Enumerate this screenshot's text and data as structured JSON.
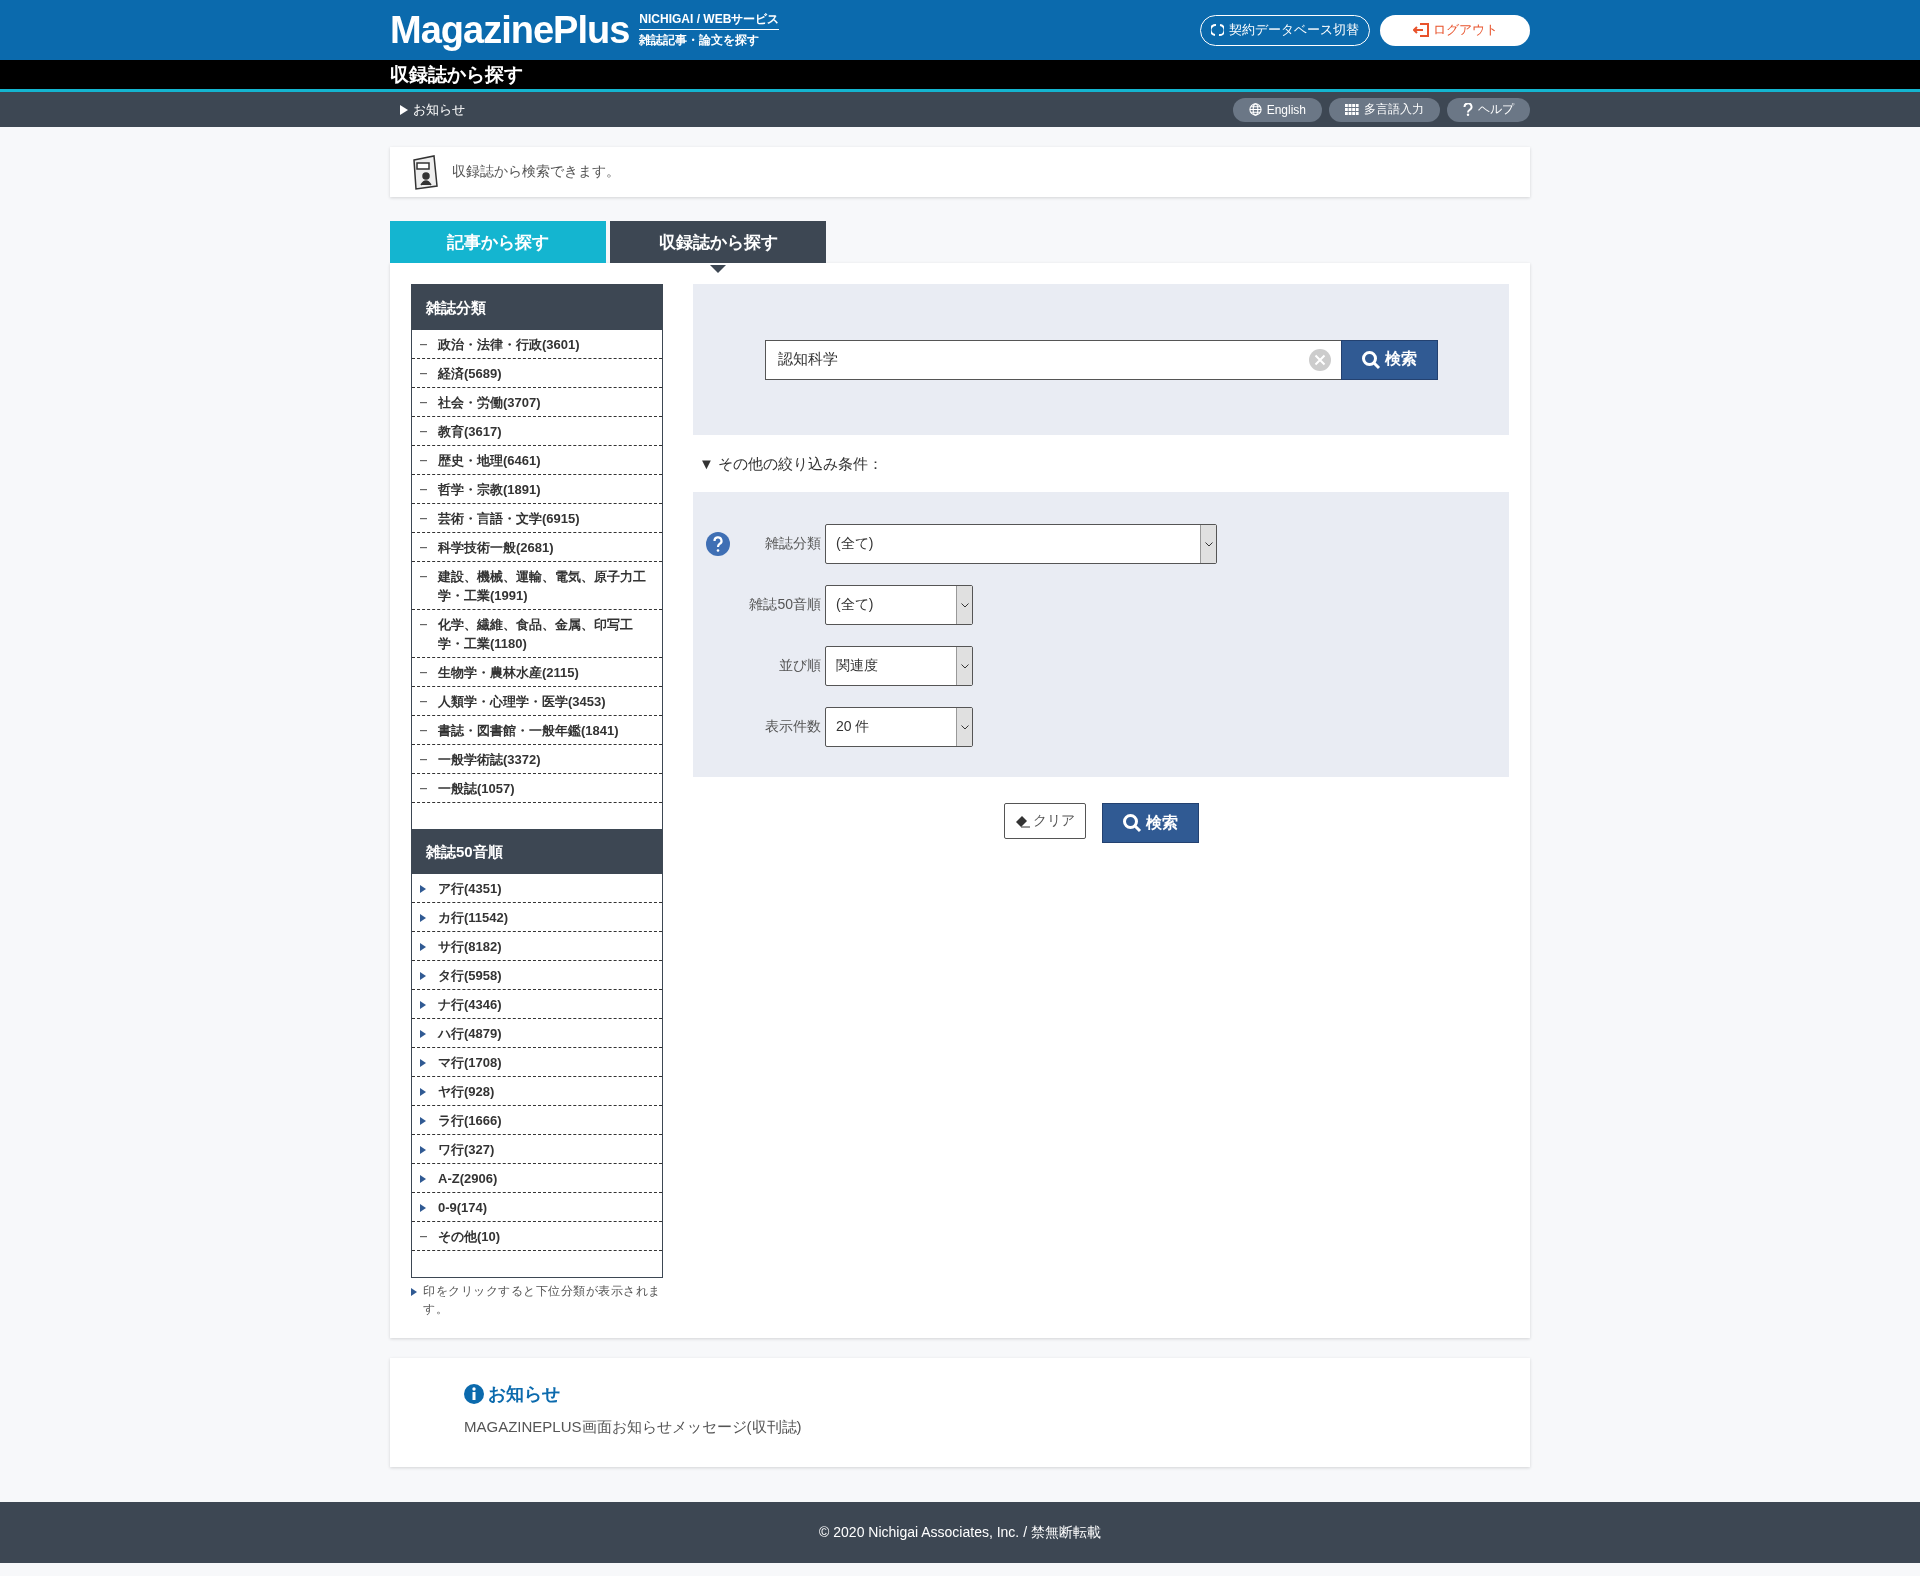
{
  "header": {
    "logo": "MagazinePlus",
    "service": "NICHIGAI / WEBサービス",
    "tagline": "雑誌記事・論文を探す",
    "switch_button": "契約データベース切替",
    "logout_button": "ログアウト"
  },
  "title_bar": {
    "title": "収録誌から探す"
  },
  "sub_bar": {
    "notice_link": "お知らせ",
    "buttons": [
      {
        "label": "English",
        "kind": "globe"
      },
      {
        "label": "多言語入力",
        "kind": "grid"
      },
      {
        "label": "ヘルプ",
        "kind": "help"
      }
    ]
  },
  "info": {
    "text": "収録誌から検索できます。"
  },
  "tabs": [
    {
      "label": "記事から探す",
      "selected": false
    },
    {
      "label": "収録誌から探す",
      "selected": true
    }
  ],
  "sidebar": {
    "sections": [
      {
        "title": "雑誌分類",
        "items": [
          {
            "label": "政治・法律・行政(3601)",
            "kind": "leaf"
          },
          {
            "label": "経済(5689)",
            "kind": "leaf"
          },
          {
            "label": "社会・労働(3707)",
            "kind": "leaf"
          },
          {
            "label": "教育(3617)",
            "kind": "leaf"
          },
          {
            "label": "歴史・地理(6461)",
            "kind": "leaf"
          },
          {
            "label": "哲学・宗教(1891)",
            "kind": "leaf"
          },
          {
            "label": "芸術・言語・文学(6915)",
            "kind": "leaf"
          },
          {
            "label": "科学技術一般(2681)",
            "kind": "leaf"
          },
          {
            "label": "建設、機械、運輸、電気、原子力工学・工業(1991)",
            "kind": "leaf"
          },
          {
            "label": "化学、繊維、食品、金属、印写工学・工業(1180)",
            "kind": "leaf"
          },
          {
            "label": "生物学・農林水産(2115)",
            "kind": "leaf"
          },
          {
            "label": "人類学・心理学・医学(3453)",
            "kind": "leaf"
          },
          {
            "label": "書誌・図書館・一般年鑑(1841)",
            "kind": "leaf"
          },
          {
            "label": "一般学術誌(3372)",
            "kind": "leaf"
          },
          {
            "label": "一般誌(1057)",
            "kind": "leaf"
          }
        ]
      },
      {
        "title": "雑誌50音順",
        "items": [
          {
            "label": "ア行(4351)",
            "kind": "branch"
          },
          {
            "label": "カ行(11542)",
            "kind": "branch"
          },
          {
            "label": "サ行(8182)",
            "kind": "branch"
          },
          {
            "label": "タ行(5958)",
            "kind": "branch"
          },
          {
            "label": "ナ行(4346)",
            "kind": "branch"
          },
          {
            "label": "ハ行(4879)",
            "kind": "branch"
          },
          {
            "label": "マ行(1708)",
            "kind": "branch"
          },
          {
            "label": "ヤ行(928)",
            "kind": "branch"
          },
          {
            "label": "ラ行(1666)",
            "kind": "branch"
          },
          {
            "label": "ワ行(327)",
            "kind": "branch"
          },
          {
            "label": "A-Z(2906)",
            "kind": "branch"
          },
          {
            "label": "0-9(174)",
            "kind": "branch"
          },
          {
            "label": "その他(10)",
            "kind": "leaf"
          }
        ]
      }
    ],
    "note": "印をクリックすると下位分類が表示されます。"
  },
  "search": {
    "value": "認知科学",
    "button": "検索"
  },
  "filters_toggle": "▼ その他の絞り込み条件：",
  "filters": [
    {
      "label": "雑誌分類",
      "value": "(全て)",
      "kind": "wide",
      "help": true
    },
    {
      "label": "雑誌50音順",
      "value": "(全て)",
      "kind": "narrow",
      "help": false
    },
    {
      "label": "並び順",
      "value": "関連度",
      "kind": "narrow",
      "help": false
    },
    {
      "label": "表示件数",
      "value": "20 件",
      "kind": "narrow",
      "help": false
    }
  ],
  "actions": {
    "clear": "クリア",
    "search": "検索"
  },
  "notice": {
    "title": "お知らせ",
    "message": "MAGAZINEPLUS画面お知らせメッセージ(収刊誌)"
  },
  "footer": {
    "text": "© 2020 Nichigai Associates, Inc. / 禁無断転載"
  }
}
